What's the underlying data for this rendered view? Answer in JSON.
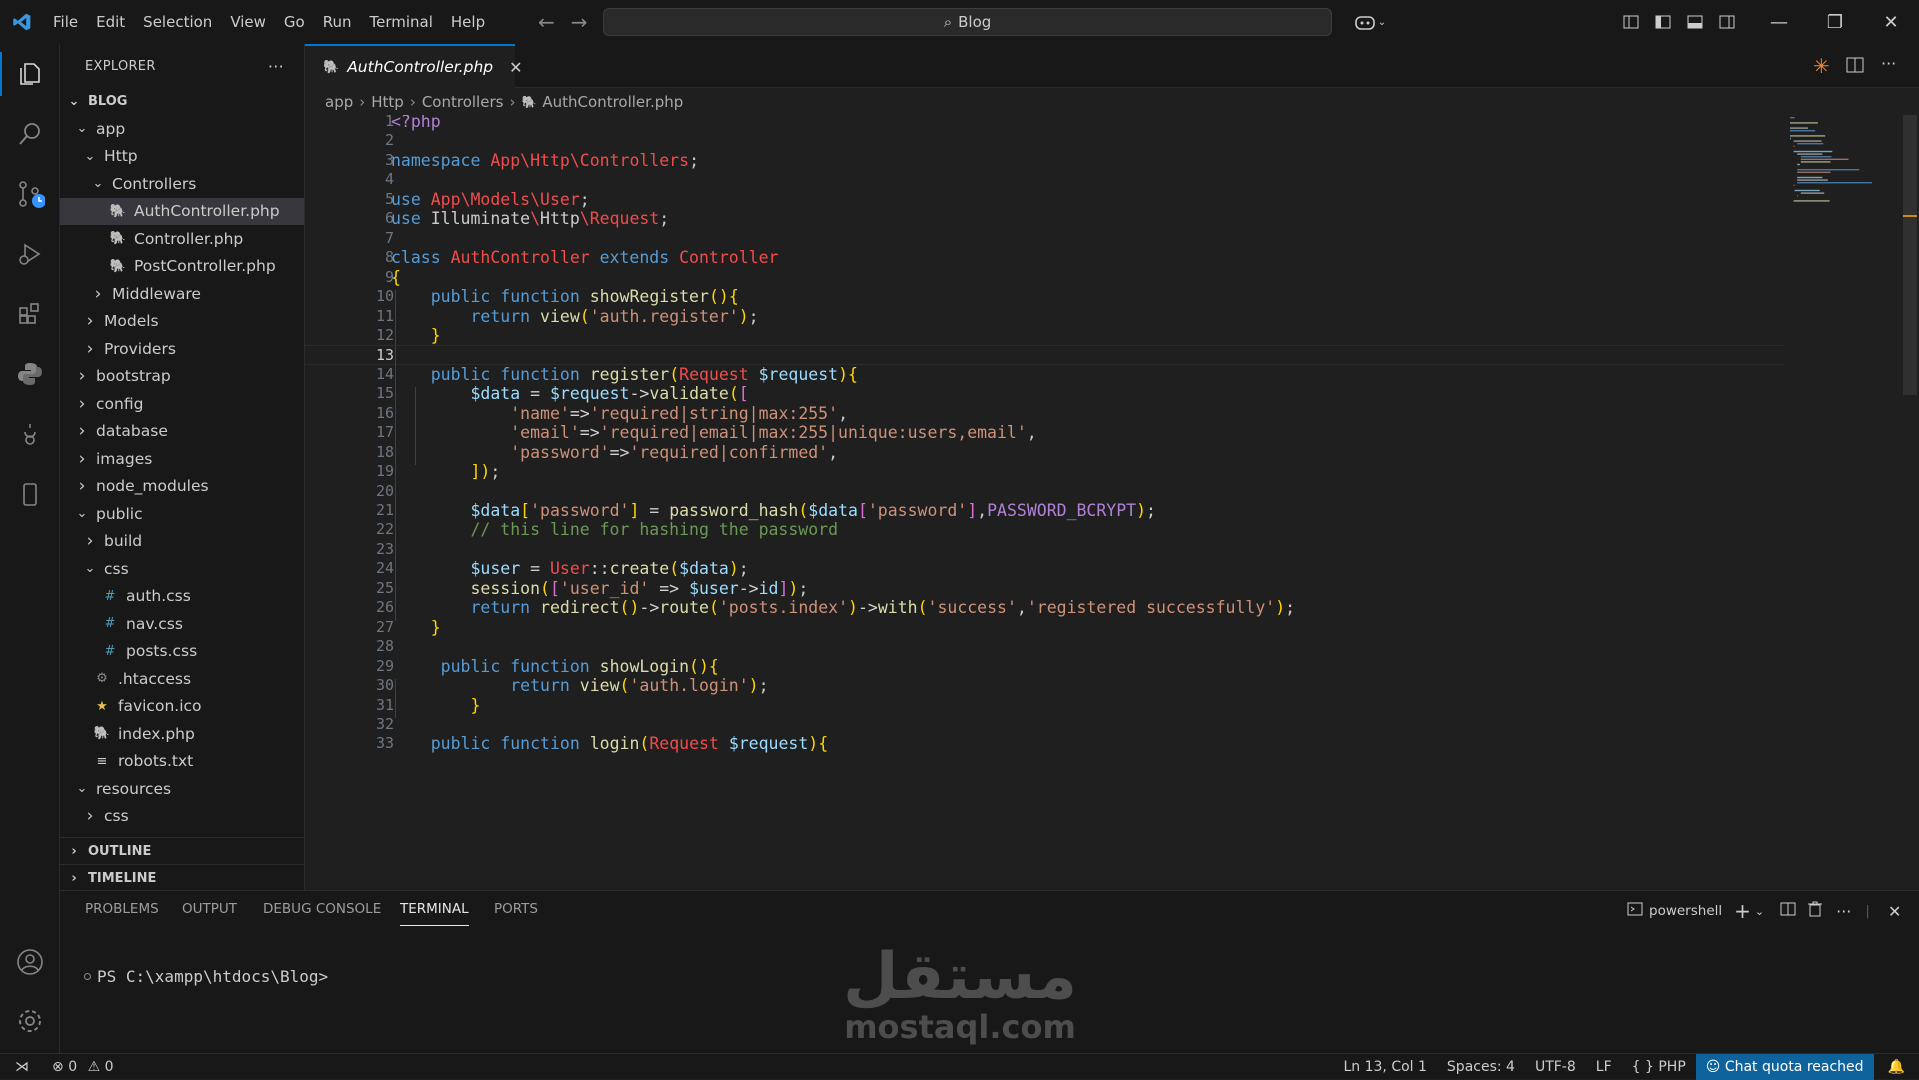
{
  "title_bar": {
    "menus": [
      "File",
      "Edit",
      "Selection",
      "View",
      "Go",
      "Run",
      "Terminal",
      "Help"
    ],
    "search_text": "Blog"
  },
  "sidebar": {
    "header": "EXPLORER",
    "project": "BLOG",
    "tree": [
      {
        "label": "app",
        "type": "folder",
        "open": true,
        "depth": 0
      },
      {
        "label": "Http",
        "type": "folder",
        "open": true,
        "depth": 1
      },
      {
        "label": "Controllers",
        "type": "folder",
        "open": true,
        "depth": 2
      },
      {
        "label": "AuthController.php",
        "type": "php",
        "depth": 3,
        "selected": true
      },
      {
        "label": "Controller.php",
        "type": "php",
        "depth": 3
      },
      {
        "label": "PostController.php",
        "type": "php",
        "depth": 3
      },
      {
        "label": "Middleware",
        "type": "folder",
        "open": false,
        "depth": 2
      },
      {
        "label": "Models",
        "type": "folder",
        "open": false,
        "depth": 1
      },
      {
        "label": "Providers",
        "type": "folder",
        "open": false,
        "depth": 1
      },
      {
        "label": "bootstrap",
        "type": "folder",
        "open": false,
        "depth": 0
      },
      {
        "label": "config",
        "type": "folder",
        "open": false,
        "depth": 0
      },
      {
        "label": "database",
        "type": "folder",
        "open": false,
        "depth": 0
      },
      {
        "label": "images",
        "type": "folder",
        "open": false,
        "depth": 0
      },
      {
        "label": "node_modules",
        "type": "folder",
        "open": false,
        "depth": 0
      },
      {
        "label": "public",
        "type": "folder",
        "open": true,
        "depth": 0
      },
      {
        "label": "build",
        "type": "folder",
        "open": false,
        "depth": 1
      },
      {
        "label": "css",
        "type": "folder",
        "open": true,
        "depth": 1
      },
      {
        "label": "auth.css",
        "type": "css",
        "depth": 2
      },
      {
        "label": "nav.css",
        "type": "css",
        "depth": 2
      },
      {
        "label": "posts.css",
        "type": "css",
        "depth": 2
      },
      {
        "label": ".htaccess",
        "type": "gear",
        "depth": 1
      },
      {
        "label": "favicon.ico",
        "type": "star",
        "depth": 1
      },
      {
        "label": "index.php",
        "type": "php",
        "depth": 1
      },
      {
        "label": "robots.txt",
        "type": "txt",
        "depth": 1
      },
      {
        "label": "resources",
        "type": "folder",
        "open": true,
        "depth": 0
      },
      {
        "label": "css",
        "type": "folder",
        "open": false,
        "depth": 1
      }
    ],
    "outline": "OUTLINE",
    "timeline": "TIMELINE"
  },
  "editor": {
    "tab": "AuthController.php",
    "breadcrumb": [
      "app",
      "Http",
      "Controllers",
      "AuthController.php"
    ],
    "current_line": 13,
    "lines": [
      "<?php",
      "",
      "namespace App\\Http\\Controllers;",
      "",
      "use App\\Models\\User;",
      "use Illuminate\\Http\\Request;",
      "",
      "class AuthController extends Controller",
      "{",
      "    public function showRegister(){",
      "        return view('auth.register');",
      "    }",
      "",
      "    public function register(Request $request){",
      "        $data = $request->validate([",
      "            'name'=>'required|string|max:255',",
      "            'email'=>'required|email|max:255|unique:users,email',",
      "            'password'=>'required|confirmed',",
      "        ]);",
      "",
      "        $data['password'] = password_hash($data['password'],PASSWORD_BCRYPT);",
      "        // this line for hashing the password",
      "",
      "        $user = User::create($data);",
      "        session(['user_id' => $user->id]);",
      "        return redirect()->route('posts.index')->with('success','registered successfully');",
      "    }",
      "",
      "     public function showLogin(){",
      "            return view('auth.login');",
      "        }",
      "",
      "    public function login(Request $request){"
    ]
  },
  "panel": {
    "tabs": [
      "PROBLEMS",
      "OUTPUT",
      "DEBUG CONSOLE",
      "TERMINAL",
      "PORTS"
    ],
    "active_tab": "TERMINAL",
    "shell": "powershell",
    "prompt": "PS C:\\xampp\\htdocs\\Blog>"
  },
  "status_bar": {
    "errors": "0",
    "warnings": "0",
    "position": "Ln 13, Col 1",
    "spaces": "Spaces: 4",
    "encoding": "UTF-8",
    "eol": "LF",
    "language": "PHP",
    "chat": "Chat quota reached"
  },
  "watermark": {
    "arabic": "مستقل",
    "latin": "mostaql.com"
  },
  "colors": {
    "accent": "#0078d4",
    "chat_badge": "#0e639c",
    "php_icon": "#a074c4"
  }
}
